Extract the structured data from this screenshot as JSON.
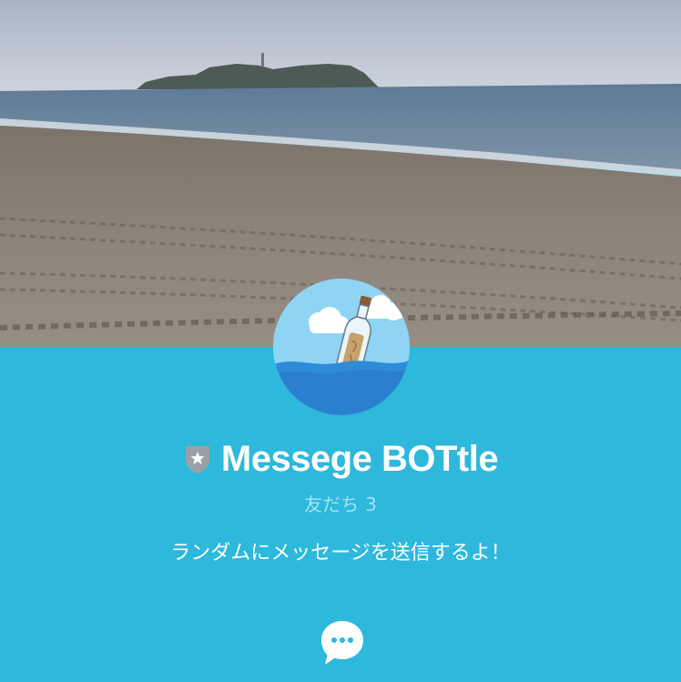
{
  "profile": {
    "name": "Messege BOTtle",
    "friends_label": "友だち",
    "friends_count": "3",
    "status_message": "ランダムにメッセージを送信するよ！"
  },
  "icons": {
    "badge": "shield-star-icon",
    "chat": "chat-bubble-icon"
  },
  "colors": {
    "background": "#2db8dc",
    "friends_text": "#a6e3f3",
    "badge": "#9aa1a6"
  }
}
